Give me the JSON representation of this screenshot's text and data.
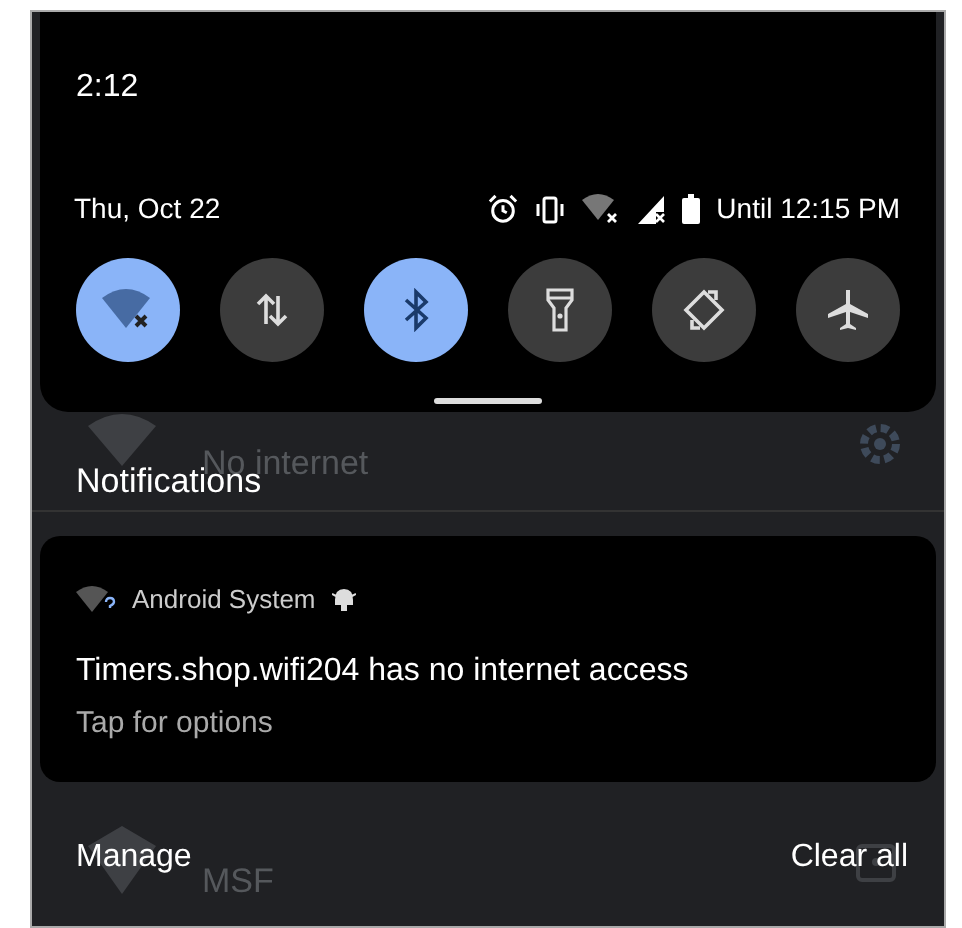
{
  "status": {
    "time": "2:12",
    "date": "Thu, Oct 22",
    "battery_text": "Until 12:15 PM"
  },
  "tiles": [
    {
      "kind": "wifi",
      "on": true
    },
    {
      "kind": "data",
      "on": false
    },
    {
      "kind": "bluetooth",
      "on": true
    },
    {
      "kind": "flashlight",
      "on": false
    },
    {
      "kind": "rotate",
      "on": false
    },
    {
      "kind": "airplane",
      "on": false
    }
  ],
  "background_networks": [
    {
      "kind": "wifi",
      "status": "No internet"
    },
    {
      "kind": "locked",
      "name": "MSF"
    }
  ],
  "notifications_header": "Notifications",
  "notification": {
    "app": "Android System",
    "title": "Timers.shop.wifi204 has no internet access",
    "text": "Tap for options"
  },
  "footer": {
    "manage": "Manage",
    "clear_all": "Clear all"
  }
}
